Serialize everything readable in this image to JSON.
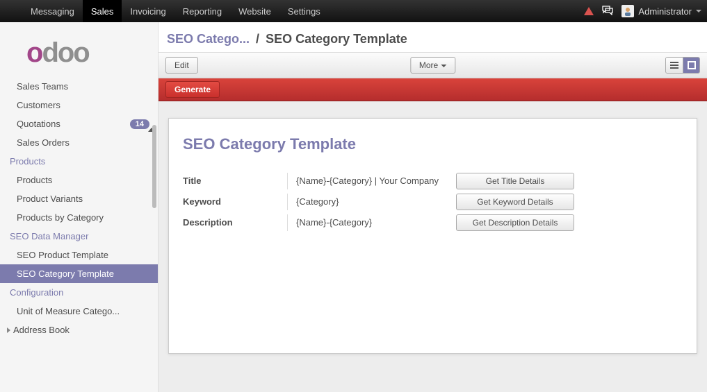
{
  "navbar": {
    "items": [
      "Messaging",
      "Sales",
      "Invoicing",
      "Reporting",
      "Website",
      "Settings"
    ],
    "active_index": 1,
    "user": "Administrator"
  },
  "logo": {
    "o": "o",
    "rest": "doo"
  },
  "sidebar": {
    "truncated_top": "",
    "groups": [
      {
        "items": [
          {
            "label": "Sales Teams"
          },
          {
            "label": "Customers"
          },
          {
            "label": "Quotations",
            "badge": "14"
          },
          {
            "label": "Sales Orders"
          }
        ]
      },
      {
        "header": "Products",
        "items": [
          {
            "label": "Products"
          },
          {
            "label": "Product Variants"
          },
          {
            "label": "Products by Category"
          }
        ]
      },
      {
        "header": "SEO Data Manager",
        "items": [
          {
            "label": "SEO Product Template"
          },
          {
            "label": "SEO Category Template",
            "active": true
          }
        ]
      },
      {
        "header": "Configuration",
        "items": [
          {
            "label": "Unit of Measure Catego..."
          }
        ]
      }
    ],
    "expand_item": "Address Book"
  },
  "breadcrumb": {
    "parent": "SEO Catego...",
    "sep": "/",
    "current": "SEO Category Template"
  },
  "toolbar": {
    "edit": "Edit",
    "more": "More",
    "generate": "Generate"
  },
  "form": {
    "title": "SEO Category Template",
    "rows": [
      {
        "label": "Title",
        "value": "{Name}-{Category} | Your Company",
        "button": "Get Title Details"
      },
      {
        "label": "Keyword",
        "value": "{Category}",
        "button": "Get Keyword Details"
      },
      {
        "label": "Description",
        "value": "{Name}-{Category}",
        "button": "Get Description Details"
      }
    ]
  }
}
